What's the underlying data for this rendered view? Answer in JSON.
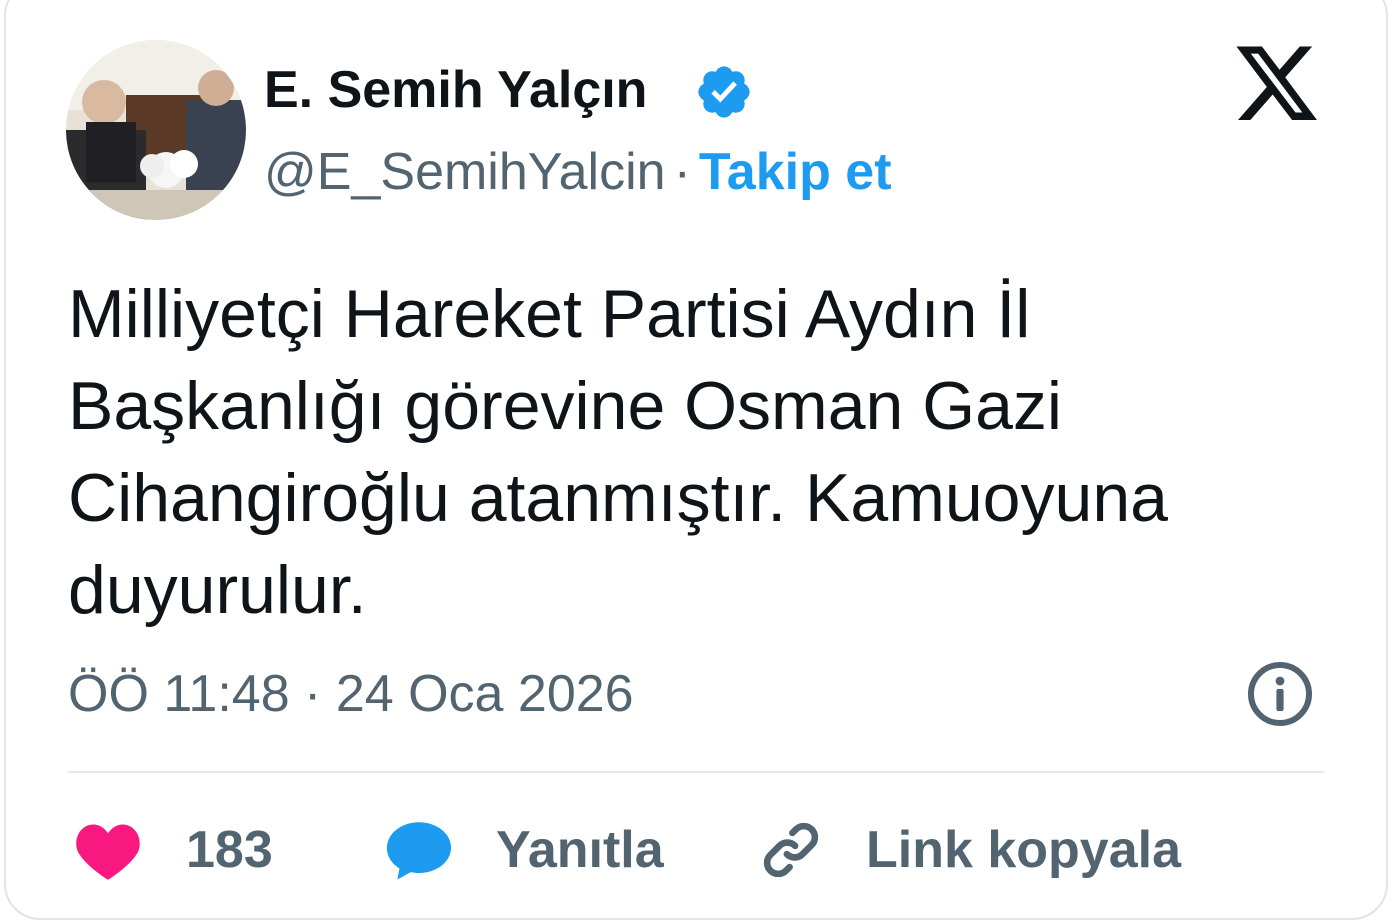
{
  "author": {
    "name": "E. Semih Yalçın",
    "handle": "@E_SemihYalcin",
    "separator": "·",
    "follow_label": "Takip et"
  },
  "tweet": {
    "text": "Milliyetçi Hareket Partisi Aydın İl Başkanlığı görevine Osman Gazi Cihangiroğlu atanmıştır. Kamuoyuna duyurulur.",
    "timestamp": "ÖÖ 11:48 · 24 Oca 2026"
  },
  "actions": {
    "like_count": "183",
    "reply_label": "Yanıtla",
    "copy_link_label": "Link kopyala"
  },
  "icons": {
    "verified": "verified-badge-icon",
    "brand": "x-logo-icon",
    "info": "info-icon",
    "like": "heart-icon",
    "reply": "speech-bubble-icon",
    "link": "link-icon"
  },
  "colors": {
    "accent": "#1d9bf0",
    "text": "#0f1419",
    "muted": "#536471",
    "heart": "#f91880"
  }
}
